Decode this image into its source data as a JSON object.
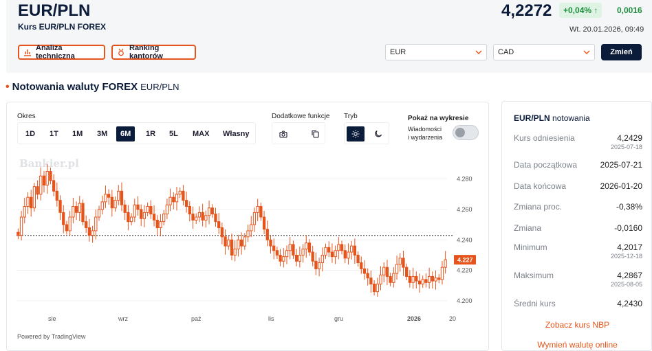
{
  "header": {
    "pair": "EUR/PLN",
    "subtitle": "Kurs EUR/PLN FOREX",
    "price": "4,2272",
    "change_pct": "+0,04% ↑",
    "change_abs": "0,0016",
    "timestamp": "Wt. 20.01.2026, 09:49"
  },
  "toolbar": {
    "technical_label": "Analiza techniczna",
    "ranking_label": "Ranking kantorów",
    "from_currency": "EUR",
    "to_currency": "CAD",
    "swap_label": "Zmień"
  },
  "section": {
    "title": "Notowania waluty FOREX",
    "pair": "EUR/PLN"
  },
  "chart_controls": {
    "period_label": "Okres",
    "periods": [
      "1D",
      "1T",
      "1M",
      "3M",
      "6M",
      "1R",
      "5L",
      "MAX",
      "Własny"
    ],
    "active_period": "6M",
    "extra_label": "Dodatkowe funkcje",
    "mode_label": "Tryb",
    "events_label": "Pokaż na wykresie",
    "events_sub1": "Wiadomości",
    "events_sub2": "i wydarzenia",
    "events_enabled": false,
    "watermark": "Bankier.pl",
    "powered_by": "Powered by TradingView"
  },
  "chart_data": {
    "type": "candlestick",
    "x_labels": [
      "sie",
      "wrz",
      "paź",
      "lis",
      "gru",
      "2026",
      "20"
    ],
    "y_ticks": [
      "4.280",
      "4.260",
      "4.240",
      "4.220",
      "4.200"
    ],
    "ylim": [
      4.195,
      4.292
    ],
    "reference_line": 4.2429,
    "last_value": "4.227",
    "closes": [
      4.243,
      4.255,
      4.262,
      4.268,
      4.261,
      4.275,
      4.27,
      4.282,
      4.276,
      4.285,
      4.279,
      4.272,
      4.266,
      4.258,
      4.25,
      4.246,
      4.255,
      4.262,
      4.258,
      4.264,
      4.252,
      4.248,
      4.243,
      4.246,
      4.255,
      4.26,
      4.265,
      4.27,
      4.268,
      4.261,
      4.266,
      4.272,
      4.263,
      4.258,
      4.252,
      4.255,
      4.263,
      4.26,
      4.254,
      4.258,
      4.262,
      4.257,
      4.253,
      4.248,
      4.252,
      4.257,
      4.263,
      4.268,
      4.265,
      4.27,
      4.272,
      4.266,
      4.262,
      4.257,
      4.253,
      4.255,
      4.258,
      4.253,
      4.256,
      4.261,
      4.257,
      4.252,
      4.248,
      4.242,
      4.236,
      4.24,
      4.23,
      4.234,
      4.24,
      4.236,
      4.242,
      4.246,
      4.25,
      4.258,
      4.262,
      4.255,
      4.247,
      4.24,
      4.236,
      4.233,
      4.23,
      4.226,
      4.229,
      4.233,
      4.237,
      4.23,
      4.226,
      4.23,
      4.234,
      4.238,
      4.232,
      4.226,
      4.221,
      4.225,
      4.23,
      4.235,
      4.232,
      4.229,
      4.233,
      4.237,
      4.233,
      4.228,
      4.232,
      4.236,
      4.23,
      4.225,
      4.221,
      4.218,
      4.215,
      4.211,
      4.206,
      4.211,
      4.217,
      4.222,
      4.216,
      4.212,
      4.218,
      4.224,
      4.228,
      4.222,
      4.216,
      4.212,
      4.216,
      4.213,
      4.211,
      4.214,
      4.212,
      4.216,
      4.213,
      4.215,
      4.214,
      4.222,
      4.227
    ]
  },
  "info": {
    "pair": "EUR/PLN",
    "heading": "notowania",
    "rows": [
      {
        "label": "Kurs odniesienia",
        "value": "4,2429",
        "date": "2025-07-18"
      },
      {
        "label": "Data początkowa",
        "value": "2025-07-21",
        "date": ""
      },
      {
        "label": "Data końcowa",
        "value": "2026-01-20",
        "date": ""
      },
      {
        "label": "Zmiana proc.",
        "value": "-0,38%",
        "date": ""
      },
      {
        "label": "Zmiana",
        "value": "-0,0160",
        "date": ""
      },
      {
        "label": "Minimum",
        "value": "4,2017",
        "date": "2025-12-18"
      },
      {
        "label": "Maksimum",
        "value": "4,2867",
        "date": "2025-08-05"
      },
      {
        "label": "Średni kurs",
        "value": "4,2430",
        "date": ""
      }
    ],
    "link_nbp": "Zobacz kurs NBP",
    "link_exchange": "Wymień walutę online"
  },
  "colors": {
    "accent": "#e5541b",
    "navy": "#0b1b3a",
    "positive": "#1e8c3d"
  }
}
